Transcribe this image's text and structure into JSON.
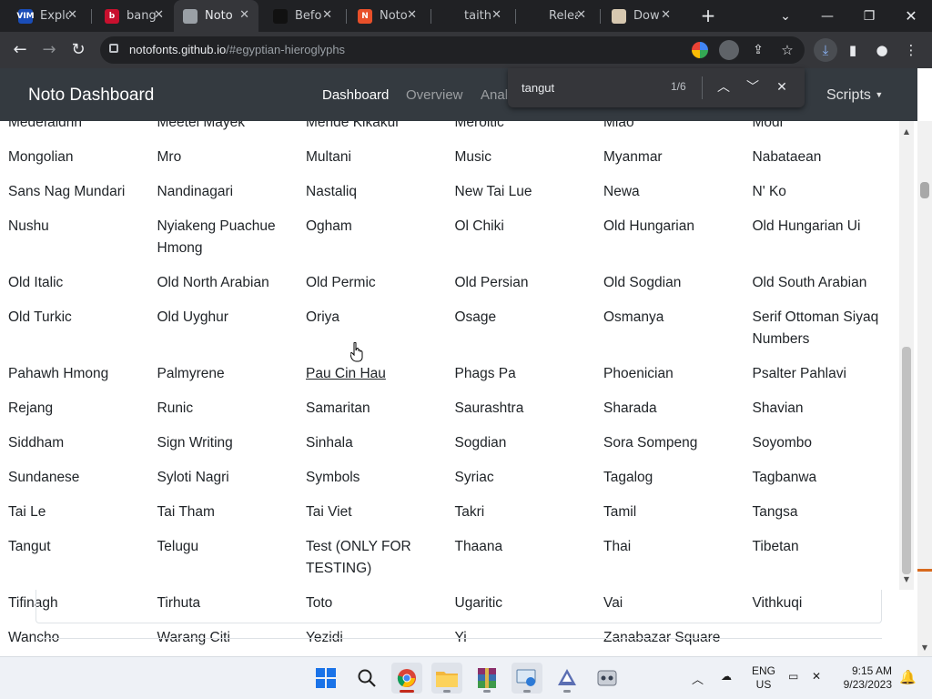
{
  "browser": {
    "tabs": [
      {
        "title": "Explo",
        "favicon_color": "#1a4db8",
        "favicon_text": "VIM",
        "active": false
      },
      {
        "title": "bang",
        "favicon_color": "#c8102e",
        "favicon_text": "b",
        "active": false
      },
      {
        "title": "Noto",
        "favicon_color": "#9aa0a6",
        "favicon_text": "",
        "active": true
      },
      {
        "title": "Befo",
        "favicon_color": "#111111",
        "favicon_text": "",
        "active": false
      },
      {
        "title": "Noto",
        "favicon_color": "#e8502a",
        "favicon_text": "N",
        "active": false
      },
      {
        "title": "taith",
        "favicon_color": "#202124",
        "favicon_text": "",
        "active": false
      },
      {
        "title": "Relea",
        "favicon_color": "#202124",
        "favicon_text": "",
        "active": false
      },
      {
        "title": "Dow",
        "favicon_color": "#d7c8b0",
        "favicon_text": "",
        "active": false
      }
    ],
    "new_tab_icon": "plus-icon",
    "url_host": "notofonts.github.io",
    "url_path": "/#egyptian-hieroglyphs"
  },
  "site": {
    "brand": "Noto Dashboard",
    "nav": [
      "Dashboard",
      "Overview",
      "Anal"
    ],
    "scripts_label": "Scripts"
  },
  "find": {
    "query": "tangut",
    "count": "1/6"
  },
  "scripts": [
    "Medefaidrin",
    "Meetei Mayek",
    "Mende Kikakui",
    "Meroitic",
    "Miao",
    "Modi",
    "Mongolian",
    "Mro",
    "Multani",
    "Music",
    "Myanmar",
    "Nabataean",
    "Sans Nag Mundari",
    "Nandinagari",
    "Nastaliq",
    "New Tai Lue",
    "Newa",
    "N' Ko",
    "Nushu",
    "Nyiakeng Puachue Hmong",
    "Ogham",
    "Ol Chiki",
    "Old Hungarian",
    "Old Hungarian Ui",
    "Old Italic",
    "Old North Arabian",
    "Old Permic",
    "Old Persian",
    "Old Sogdian",
    "Old South Arabian",
    "Old Turkic",
    "Old Uyghur",
    "Oriya",
    "Osage",
    "Osmanya",
    "Serif Ottoman Siyaq Numbers",
    "Pahawh Hmong",
    "Palmyrene",
    "Pau Cin Hau",
    "Phags Pa",
    "Phoenician",
    "Psalter Pahlavi",
    "Rejang",
    "Runic",
    "Samaritan",
    "Saurashtra",
    "Sharada",
    "Shavian",
    "Siddham",
    "Sign Writing",
    "Sinhala",
    "Sogdian",
    "Sora Sompeng",
    "Soyombo",
    "Sundanese",
    "Syloti Nagri",
    "Symbols",
    "Syriac",
    "Tagalog",
    "Tagbanwa",
    "Tai Le",
    "Tai Tham",
    "Tai Viet",
    "Takri",
    "Tamil",
    "Tangsa",
    "Tangut",
    "Telugu",
    "Test (ONLY FOR TESTING)",
    "Thaana",
    "Thai",
    "Tibetan",
    "Tifinagh",
    "Tirhuta",
    "Toto",
    "Ugaritic",
    "Vai",
    "Vithkuqi",
    "Wancho",
    "Warang Citi",
    "Yezidi",
    "Yi",
    "Zanabazar Square",
    ""
  ],
  "hovered_script": "Pau Cin Hau",
  "taskbar": {
    "lang_top": "ENG",
    "lang_bottom": "US",
    "time": "9:15 AM",
    "date": "9/23/2023"
  }
}
